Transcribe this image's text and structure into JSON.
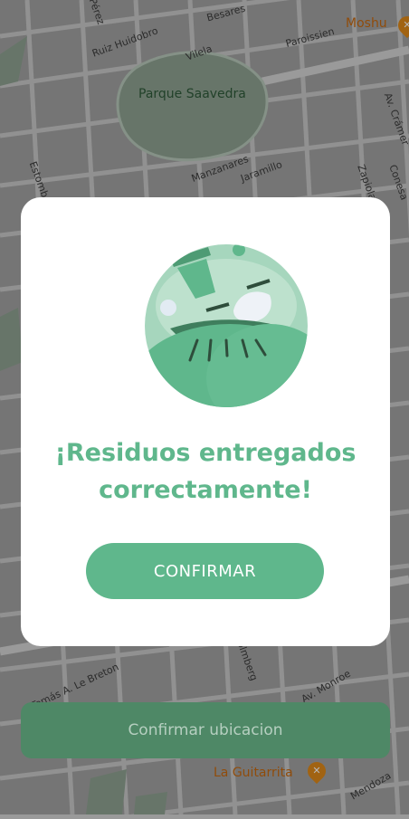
{
  "map": {
    "streets": [
      "Pérez",
      "Besares",
      "Ruiz Huidobro",
      "Vilela",
      "Paroissien",
      "Av. Crámer",
      "Estomba",
      "Manzanares",
      "Jaramillo",
      "Zapiola",
      "Conesa",
      "Tomás A. Le Breton",
      "Av. Monroe",
      "Holmberg",
      "Mendoza"
    ],
    "park": "Parque Saavedra",
    "pois": [
      {
        "name": "Moshu",
        "icon": "restaurant-pin-icon"
      },
      {
        "name": "La Guitarrita",
        "icon": "restaurant-pin-icon"
      }
    ]
  },
  "modal": {
    "title_line1": "¡Residuos entregados",
    "title_line2": "correctamente!",
    "illustration_icon": "waste-delivered-illustration",
    "confirm_label": "CONFIRMAR"
  },
  "footer": {
    "confirm_location_label": "Confirmar ubicacion"
  },
  "colors": {
    "accent": "#5fb78c",
    "accent_dark": "#4e8866",
    "map_bg": "#9a9a9a"
  }
}
